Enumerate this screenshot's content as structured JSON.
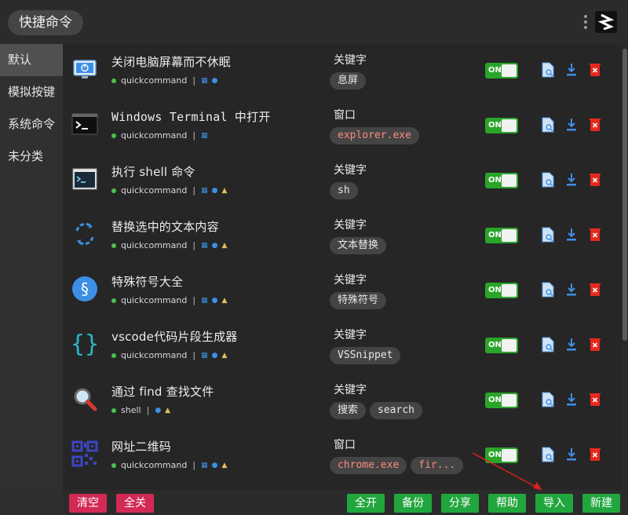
{
  "header": {
    "title": "快捷命令",
    "more_icon": "kebab-menu-icon",
    "logo_icon": "quickcommand-logo-icon"
  },
  "sidebar": {
    "items": [
      {
        "label": "默认",
        "active": true
      },
      {
        "label": "模拟按键"
      },
      {
        "label": "系统命令"
      },
      {
        "label": "未分类"
      }
    ]
  },
  "commands": [
    {
      "title": "关闭电脑屏幕而不休眠",
      "tag": "quickcommand",
      "platforms": [
        "win",
        "mac"
      ],
      "feature_type": "关键字",
      "keywords": [
        "息屏"
      ],
      "keyword_style": "light",
      "enabled": "ON",
      "icon": "monitor-power-icon"
    },
    {
      "title": "Windows Terminal 中打开",
      "tag": "quickcommand",
      "platforms": [
        "win"
      ],
      "feature_type": "窗口",
      "keywords": [
        "explorer.exe"
      ],
      "keyword_style": "red",
      "enabled": "ON",
      "icon": "terminal-dark-icon"
    },
    {
      "title": "执行 shell 命令",
      "tag": "quickcommand",
      "platforms": [
        "win",
        "mac",
        "linux"
      ],
      "feature_type": "关键字",
      "keywords": [
        "sh"
      ],
      "keyword_style": "light",
      "enabled": "ON",
      "icon": "terminal-window-icon"
    },
    {
      "title": "替换选中的文本内容",
      "tag": "quickcommand",
      "platforms": [
        "win",
        "mac",
        "linux"
      ],
      "feature_type": "关键字",
      "keywords": [
        "文本替换"
      ],
      "keyword_style": "light",
      "enabled": "ON",
      "icon": "replace-arrows-icon"
    },
    {
      "title": "特殊符号大全",
      "tag": "quickcommand",
      "platforms": [
        "win",
        "mac",
        "linux"
      ],
      "feature_type": "关键字",
      "keywords": [
        "特殊符号"
      ],
      "keyword_style": "light",
      "enabled": "ON",
      "icon": "section-sign-icon"
    },
    {
      "title": "vscode代码片段生成器",
      "tag": "quickcommand",
      "platforms": [
        "win",
        "mac",
        "linux"
      ],
      "feature_type": "关键字",
      "keywords": [
        "VSSnippet"
      ],
      "keyword_style": "light",
      "enabled": "ON",
      "icon": "curly-braces-icon"
    },
    {
      "title": "通过 find 查找文件",
      "tag": "shell",
      "platforms": [
        "mac",
        "linux"
      ],
      "feature_type": "关键字",
      "keywords": [
        "搜索",
        "search"
      ],
      "keyword_style": "light",
      "enabled": "ON",
      "icon": "magnifier-icon"
    },
    {
      "title": "网址二维码",
      "tag": "quickcommand",
      "platforms": [
        "win",
        "mac",
        "linux"
      ],
      "feature_type": "窗口",
      "keywords": [
        "chrome.exe",
        "fir..."
      ],
      "keyword_style": "red",
      "enabled": "ON",
      "icon": "qr-code-icon"
    }
  ],
  "footer": {
    "clear": "清空",
    "disable_all": "全关",
    "enable_all": "全开",
    "backup": "备份",
    "share": "分享",
    "help": "帮助",
    "import": "导入",
    "new": "新建"
  },
  "colors": {
    "accent_green": "#21a63d",
    "danger_red": "#d22a55",
    "chip_red_text": "#ff8a80"
  }
}
